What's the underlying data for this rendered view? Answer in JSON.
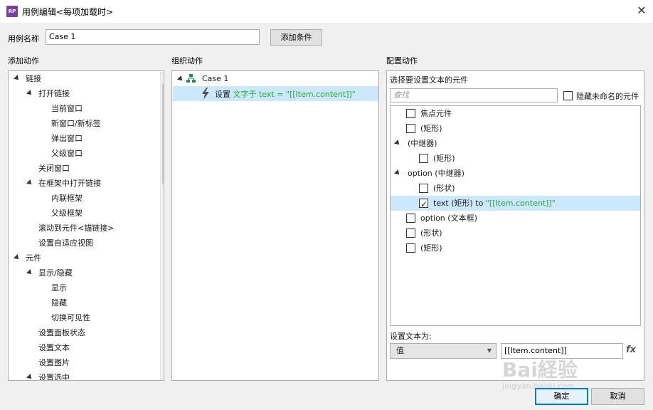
{
  "window": {
    "app_icon_text": "RP",
    "title": "用例编辑<每项加载时>",
    "close_glyph": "✕"
  },
  "case_name": {
    "label": "用例名称",
    "value": "Case 1",
    "add_condition_label": "添加条件"
  },
  "add_actions": {
    "heading": "添加动作",
    "items": [
      {
        "label": "链接",
        "level": 0,
        "expanded": true
      },
      {
        "label": "打开链接",
        "level": 1,
        "expanded": true
      },
      {
        "label": "当前窗口",
        "level": 2
      },
      {
        "label": "新窗口/新标签",
        "level": 2
      },
      {
        "label": "弹出窗口",
        "level": 2
      },
      {
        "label": "父级窗口",
        "level": 2
      },
      {
        "label": "关闭窗口",
        "level": 1
      },
      {
        "label": "在框架中打开链接",
        "level": 1,
        "expanded": true
      },
      {
        "label": "内联框架",
        "level": 2
      },
      {
        "label": "父级框架",
        "level": 2
      },
      {
        "label": "滚动到元件<锚链接>",
        "level": 1
      },
      {
        "label": "设置自适应视图",
        "level": 1
      },
      {
        "label": "元件",
        "level": 0,
        "expanded": true
      },
      {
        "label": "显示/隐藏",
        "level": 1,
        "expanded": true
      },
      {
        "label": "显示",
        "level": 2
      },
      {
        "label": "隐藏",
        "level": 2
      },
      {
        "label": "切换可见性",
        "level": 2
      },
      {
        "label": "设置面板状态",
        "level": 1
      },
      {
        "label": "设置文本",
        "level": 1
      },
      {
        "label": "设置图片",
        "level": 1
      },
      {
        "label": "设置选中",
        "level": 1,
        "expanded": true
      }
    ]
  },
  "organize_actions": {
    "heading": "组织动作",
    "case_label": "Case 1",
    "action_prefix": "设置",
    "action_detail": "文字于 text = \"[[Item.content]]\""
  },
  "configure_actions": {
    "heading": "配置动作",
    "subheading": "选择要设置文本的元件",
    "search_placeholder": "查找",
    "hide_unnamed_label": "隐藏未命名的元件",
    "widgets": [
      {
        "label": "焦点元件",
        "checked": false,
        "type": "check",
        "indent": 0
      },
      {
        "label": "(矩形)",
        "checked": false,
        "type": "check",
        "indent": 0
      },
      {
        "label": "(中继器)",
        "type": "group",
        "indent": 0
      },
      {
        "label": "(矩形)",
        "checked": false,
        "type": "check",
        "indent": 1
      },
      {
        "label": "option (中继器)",
        "type": "group",
        "indent": 0
      },
      {
        "label": "(形状)",
        "checked": false,
        "type": "check",
        "indent": 1
      },
      {
        "label": "text (矩形) to",
        "value": "\"[[Item.content]]\"",
        "checked": true,
        "type": "check",
        "indent": 1,
        "selected": true
      },
      {
        "label": "option (文本框)",
        "checked": false,
        "type": "check",
        "indent": 0
      },
      {
        "label": "(形状)",
        "checked": false,
        "type": "check",
        "indent": 0
      },
      {
        "label": "(矩形)",
        "checked": false,
        "type": "check",
        "indent": 0
      }
    ],
    "set_text_label": "设置文本为:",
    "value_type": "值",
    "value_text": "[[Item.content]]",
    "fx_label": "fx"
  },
  "footer": {
    "ok_label": "确定",
    "cancel_label": "取消"
  },
  "watermark": {
    "text": "Bai経验",
    "subtext": "jingyan.baidu.com"
  },
  "colors": {
    "accent_selection": "#cce8ff",
    "green_text": "#2aa52a",
    "ok_border": "#0078d7"
  }
}
